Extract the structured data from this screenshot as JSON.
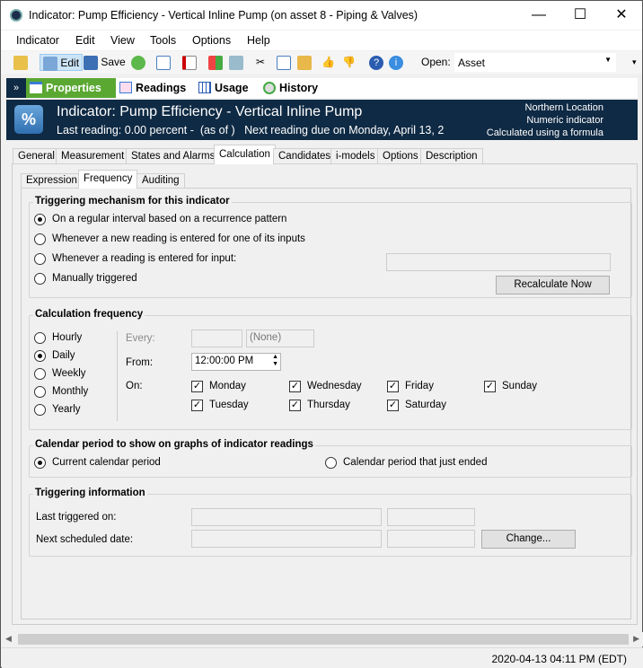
{
  "window": {
    "title": "Indicator: Pump Efficiency - Vertical Inline Pump (on asset 8 - Piping & Valves)",
    "minimize": "—",
    "maximize": "☐",
    "close": "✕"
  },
  "menu": [
    "Indicator",
    "Edit",
    "View",
    "Tools",
    "Options",
    "Help"
  ],
  "toolbar": {
    "edit": "Edit",
    "save": "Save",
    "open_label": "Open:",
    "open_value": "Asset"
  },
  "nav": {
    "properties": "Properties",
    "readings": "Readings",
    "usage": "Usage",
    "history": "History"
  },
  "header": {
    "icon": "%",
    "title": "Indicator: Pump Efficiency - Vertical Inline Pump",
    "subtitle": "Last reading: 0.00 percent -  (as of )   Next reading due on Monday, April 13, 2",
    "right": [
      "Northern Location",
      "Numeric indicator",
      "Calculated using a formula"
    ]
  },
  "tabs": [
    "General",
    "Measurement",
    "States and Alarms",
    "Calculation",
    "Candidates",
    "i-models",
    "Options",
    "Description"
  ],
  "subtabs": [
    "Expression",
    "Frequency",
    "Auditing"
  ],
  "triggering": {
    "title": "Triggering mechanism for this indicator",
    "options": [
      "On a regular interval based on a recurrence pattern",
      "Whenever a new reading is entered for one of its inputs",
      "Whenever a reading is entered for input:",
      "Manually triggered"
    ],
    "recalc": "Recalculate Now"
  },
  "frequency": {
    "title": "Calculation frequency",
    "options": [
      "Hourly",
      "Daily",
      "Weekly",
      "Monthly",
      "Yearly"
    ],
    "every_label": "Every:",
    "every_unit": "(None)",
    "from_label": "From:",
    "from_value": "12:00:00 PM",
    "on_label": "On:",
    "days": [
      "Monday",
      "Wednesday",
      "Friday",
      "Sunday",
      "Tuesday",
      "Thursday",
      "Saturday"
    ]
  },
  "calendar": {
    "title": "Calendar period to show on graphs of indicator readings",
    "options": [
      "Current calendar period",
      "Calendar period that just ended"
    ]
  },
  "info": {
    "title": "Triggering information",
    "last": "Last triggered on:",
    "next": "Next scheduled date:",
    "change": "Change..."
  },
  "status": "2020-04-13 04:11 PM (EDT)"
}
